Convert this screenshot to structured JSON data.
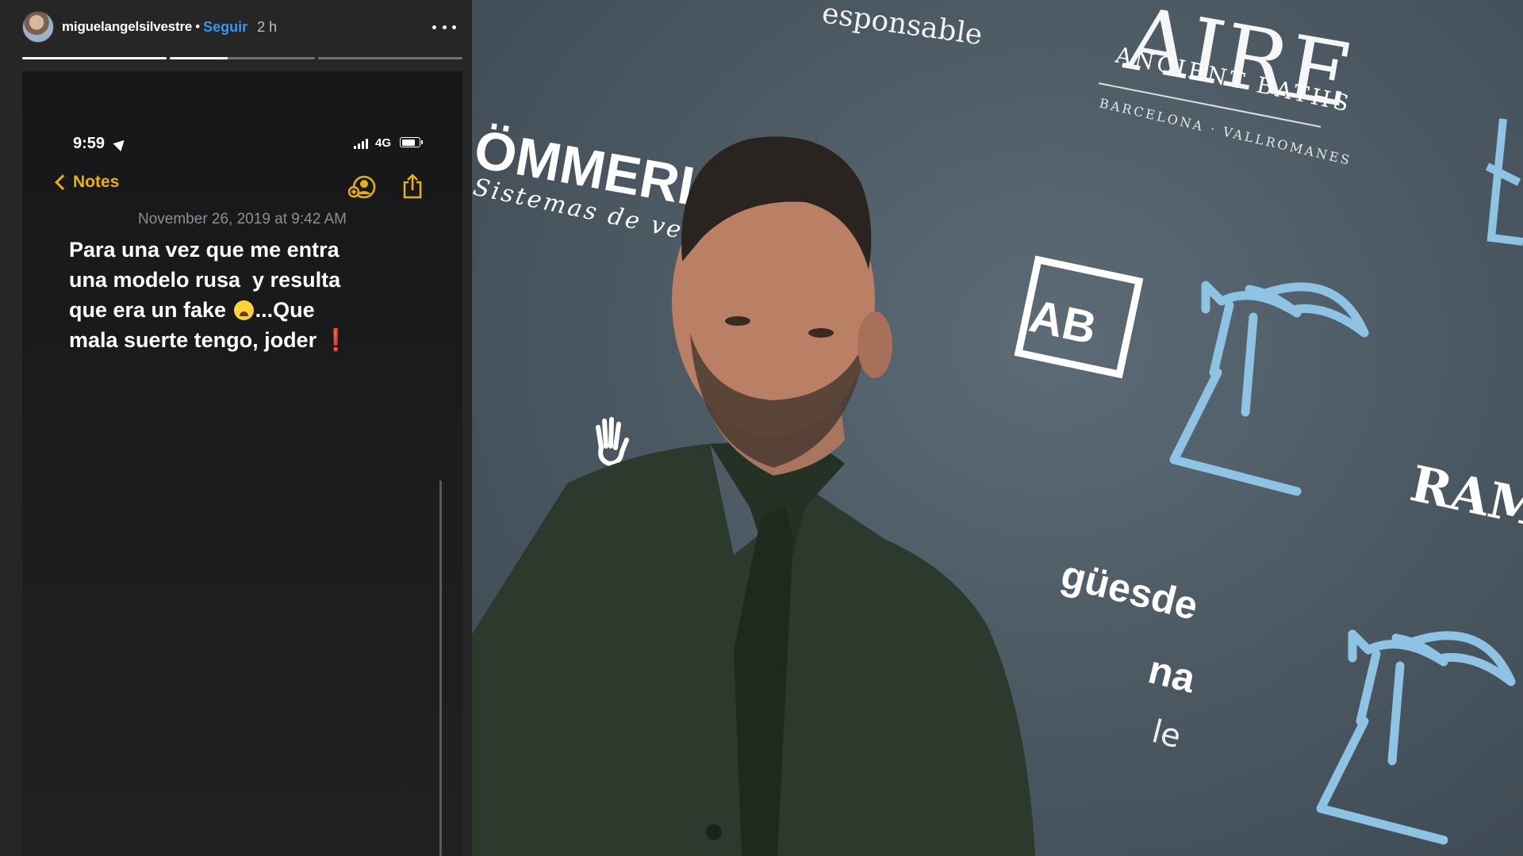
{
  "story": {
    "username": "miguelangelsilvestre",
    "separator": "•",
    "follow_label": "Seguir",
    "time_ago": "2 h",
    "progress": [
      1.0,
      0.4,
      0.0
    ],
    "more_icon": "more-horizontal-icon"
  },
  "phone": {
    "status": {
      "time": "9:59",
      "network": "4G",
      "battery_level": 0.8
    },
    "nav": {
      "back_label": "Notes"
    },
    "note": {
      "date": "November 26, 2019 at 9:42 AM",
      "line1": "Para una vez que me entra",
      "line2": "una modelo rusa  y resulta",
      "line3a": "que era un fake",
      "line3b": "...Que",
      "line4": "mala suerte tengo, joder",
      "exclamation": "❗"
    }
  },
  "photo": {
    "backdrop": {
      "top_text": "esponsable",
      "brand_aire": "AIRE",
      "aire_sub": "ANCIENT BATHS",
      "aire_city": "BARCELONA · VALLROMANES",
      "brand_kommerling": "ÖMMERLING",
      "registered": "®",
      "kommerling_sub": "Sistemas de ventanas",
      "ab_box": "AB",
      "ram": "RAM",
      "lower_text_1": "güesde",
      "lower_text_2": "na",
      "lower_text_3": "le"
    },
    "colors": {
      "wall": "#4f5c66",
      "logo_blue": "#8fc3e3",
      "suit": "#2c3a2d"
    }
  }
}
